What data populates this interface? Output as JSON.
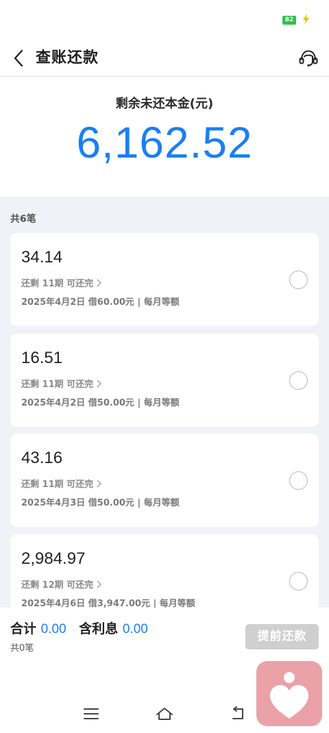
{
  "status_bar": {
    "battery_level": "82"
  },
  "header": {
    "title": "查账还款"
  },
  "summary": {
    "label": "剩余未还本金(元)",
    "amount": "6,162.52"
  },
  "list": {
    "count_label": "共6笔",
    "items": [
      {
        "amount": "34.14",
        "remaining": "还剩 11期 可还完",
        "detail": "2025年4月2日 借60.00元 | 每月等额"
      },
      {
        "amount": "16.51",
        "remaining": "还剩 11期 可还完",
        "detail": "2025年4月2日 借50.00元 | 每月等额"
      },
      {
        "amount": "43.16",
        "remaining": "还剩 11期 可还完",
        "detail": "2025年4月3日 借50.00元 | 每月等额"
      },
      {
        "amount": "2,984.97",
        "remaining": "还剩 12期 可还完",
        "detail": "2025年4月6日 借3,947.00元 | 每月等额"
      }
    ]
  },
  "footer": {
    "total_label": "合计",
    "total_value": "0.00",
    "interest_label": "含利息",
    "interest_value": "0.00",
    "count_label": "共0笔",
    "prepay_button": "提前还款"
  },
  "colors": {
    "accent": "#1a7ff2",
    "button_disabled": "#cfcfcf",
    "list_background": "#eff2f7"
  },
  "icons": {
    "back": "chevron-left-icon",
    "service": "headset-icon",
    "chevron": "chevron-right-icon",
    "nav_menu": "menu-icon",
    "nav_home": "home-icon",
    "nav_back": "return-icon"
  }
}
